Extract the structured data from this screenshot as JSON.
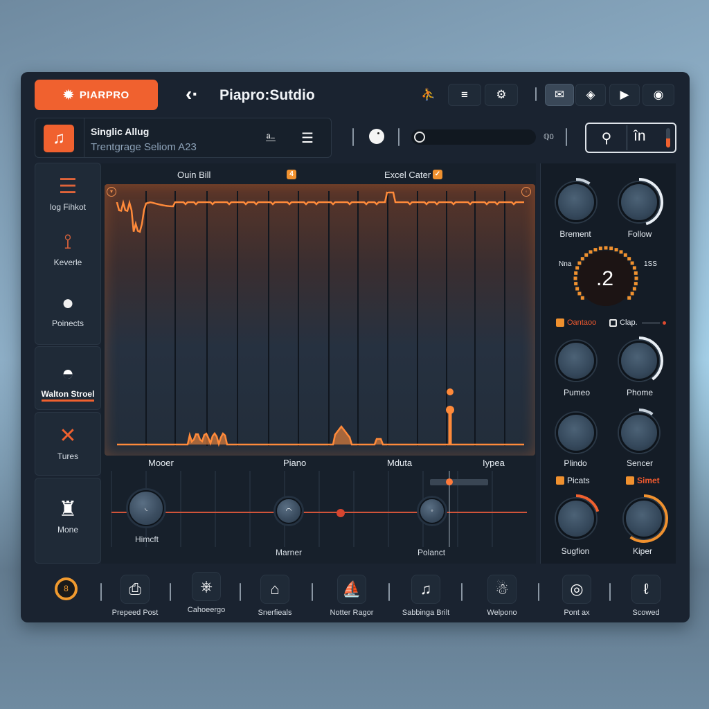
{
  "app": {
    "brand_label": "PIARPRO",
    "title": "Piapro:Sutdio"
  },
  "toolbar": {
    "buttons": [
      {
        "name": "figure-icon",
        "glyph": "⛹"
      },
      {
        "name": "menu-icon",
        "glyph": "≡"
      },
      {
        "name": "settings-icon",
        "glyph": "⚙"
      },
      {
        "name": "inbox-icon",
        "glyph": "✉"
      },
      {
        "name": "tag-icon",
        "glyph": "◈"
      },
      {
        "name": "play-icon",
        "glyph": "▶"
      },
      {
        "name": "eye-icon",
        "glyph": "◉"
      }
    ]
  },
  "track": {
    "name": "Singlic Allug",
    "subtitle": "Trentgrage Seliom A23",
    "icon": "♫",
    "action_icons": [
      "⎁",
      "☰"
    ]
  },
  "transport": {
    "scrub_value": "ℚ0",
    "search_icon": "⚲",
    "in_label": "în",
    "level_meter": 0.45
  },
  "sidebar": {
    "items": [
      {
        "label": "log Fihkot",
        "icon": "☰",
        "active": false
      },
      {
        "label": "Keverle",
        "icon": "⚲",
        "active": false
      },
      {
        "label": "Poinects",
        "icon": "",
        "active": false
      },
      {
        "label": "Walton Stroel",
        "icon": "◓",
        "active": true
      },
      {
        "label": "Tures",
        "icon": "✕",
        "active": false
      },
      {
        "label": "Mone",
        "icon": "♜",
        "active": false
      }
    ]
  },
  "main": {
    "title_left": "Ouin Bill",
    "title_right": "Excel Cater",
    "badge_left": "4",
    "badge_right": "✓",
    "lane_labels": [
      "Mooer",
      "Piano",
      "Mduta",
      "Iypea"
    ],
    "mixer_knobs": [
      {
        "label": "Himcft",
        "mark": "◟"
      },
      {
        "label": "Marner",
        "mark": "◠"
      },
      {
        "label": "Polanct",
        "mark": "◦"
      }
    ]
  },
  "right_panel": {
    "knobs_top": [
      {
        "label": "Brement",
        "value": 0.1
      },
      {
        "label": "Follow",
        "value": 0.45
      }
    ],
    "dial": {
      "value": ".2",
      "left_label": "Nna",
      "right_label": "1SS"
    },
    "toggles": [
      {
        "label": "Oantaoo",
        "checked": true
      },
      {
        "label": "Clap.",
        "checked": false
      }
    ],
    "knobs_mid": [
      {
        "label": "Pumeo",
        "value": 0.0
      },
      {
        "label": "Phome",
        "value": 0.4
      },
      {
        "label": "Plindo",
        "value": 0.0
      },
      {
        "label": "Sencer",
        "value": 0.1
      }
    ],
    "tags": [
      {
        "label": "Picats",
        "color": "#e6ecf2"
      },
      {
        "label": "Simet",
        "color": "#f05a2f"
      }
    ],
    "knobs_bottom": [
      {
        "label": "Sugfion",
        "value": 0.2
      },
      {
        "label": "Kiper",
        "value": 0.6
      }
    ]
  },
  "bottom_bar": {
    "record_glyph": "8",
    "items": [
      {
        "label": "Prepeed Post",
        "icon": "⎙"
      },
      {
        "label": "Cahoeergo",
        "icon": "⎈"
      },
      {
        "label": "Snerfieals",
        "icon": "⌂"
      },
      {
        "label": "Notter Ragor",
        "icon": "⛵"
      },
      {
        "label": "Sabbinga Brilt",
        "icon": "♫"
      },
      {
        "label": "Welpono",
        "icon": "☃"
      },
      {
        "label": "Pont ax",
        "icon": "◎"
      },
      {
        "label": "Scowed",
        "icon": "ℓ"
      }
    ]
  },
  "colors": {
    "accent": "#f0612f",
    "accent_light": "#f0912f",
    "panel": "#1a2330",
    "panel_dark": "#141c26"
  }
}
